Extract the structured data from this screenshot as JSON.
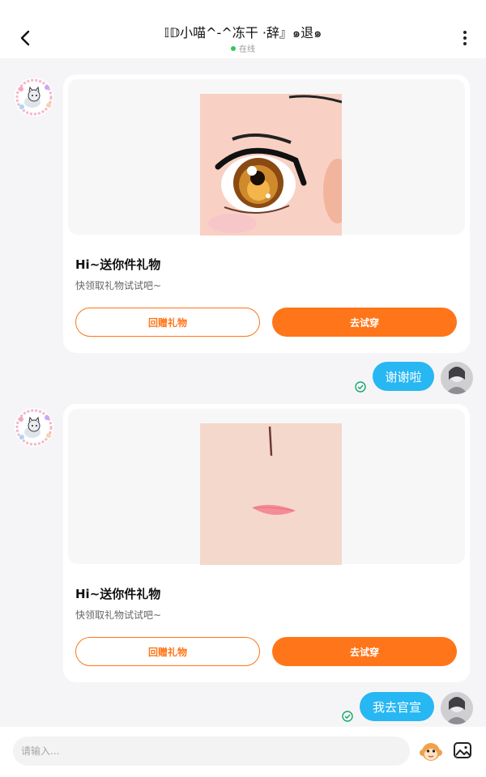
{
  "header": {
    "title": "𝕀𝔻小喵^-^冻干 ·辞』๑退๑",
    "status": "在线"
  },
  "messages": [
    {
      "type": "gift_card",
      "title": "Hi~送你件礼物",
      "subtitle": "快领取礼物试试吧~",
      "return_gift_label": "回赠礼物",
      "try_on_label": "去试穿",
      "item": "eye"
    },
    {
      "type": "outgoing_text",
      "text": "谢谢啦"
    },
    {
      "type": "gift_card",
      "title": "Hi~送你件礼物",
      "subtitle": "快领取礼物试试吧~",
      "return_gift_label": "回赠礼物",
      "try_on_label": "去试穿",
      "item": "nose_mouth"
    },
    {
      "type": "outgoing_text",
      "text": "我去官宣"
    }
  ],
  "composer": {
    "placeholder": "请输入..."
  },
  "colors": {
    "accent": "#ff7519",
    "bubble": "#27b7f3",
    "online": "#35c759",
    "read_check": "#14a86b"
  }
}
